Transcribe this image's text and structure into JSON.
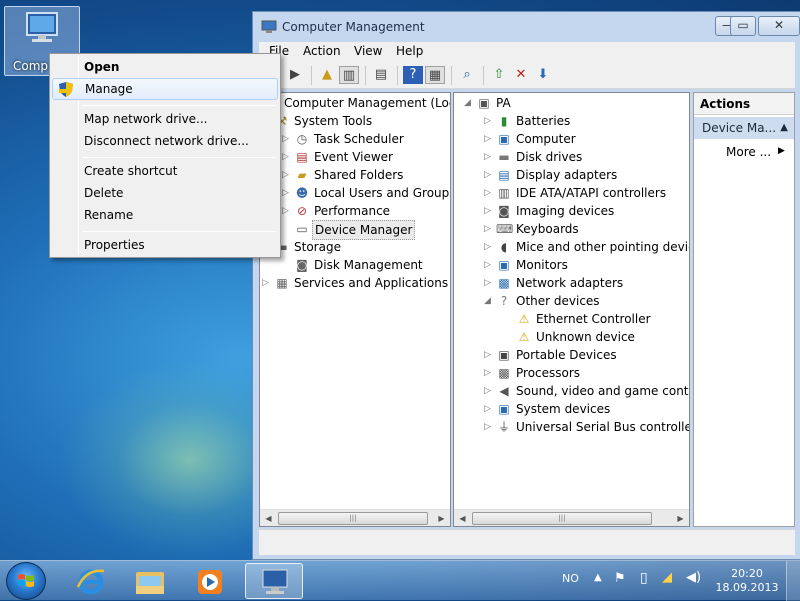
{
  "desktop": {
    "icon_label": "Comp"
  },
  "context_menu": {
    "items": [
      {
        "label": "Open"
      },
      {
        "label": "Manage"
      },
      {
        "label": "Map network drive..."
      },
      {
        "label": "Disconnect network drive..."
      },
      {
        "label": "Create shortcut"
      },
      {
        "label": "Delete"
      },
      {
        "label": "Rename"
      },
      {
        "label": "Properties"
      }
    ]
  },
  "window": {
    "title": "Computer Management",
    "controls": {
      "minimize": "—",
      "maximize": "▭",
      "close": "✕"
    },
    "menu": [
      "File",
      "Action",
      "View",
      "Help"
    ],
    "left_tree": [
      {
        "label": "Computer Management (Local",
        "icon": "computer-management-icon"
      },
      {
        "label": "System Tools",
        "icon": "tools-icon"
      },
      {
        "label": "Task Scheduler",
        "icon": "clock-icon"
      },
      {
        "label": "Event Viewer",
        "icon": "event-viewer-icon"
      },
      {
        "label": "Shared Folders",
        "icon": "shared-folder-icon"
      },
      {
        "label": "Local Users and Groups",
        "icon": "users-icon"
      },
      {
        "label": "Performance",
        "icon": "performance-icon"
      },
      {
        "label": "Device Manager",
        "icon": "device-manager-icon"
      },
      {
        "label": "Storage",
        "icon": "storage-icon"
      },
      {
        "label": "Disk Management",
        "icon": "disk-icon"
      },
      {
        "label": "Services and Applications",
        "icon": "services-icon"
      }
    ],
    "device_tree": [
      {
        "label": "PA"
      },
      {
        "label": "Batteries"
      },
      {
        "label": "Computer"
      },
      {
        "label": "Disk drives"
      },
      {
        "label": "Display adapters"
      },
      {
        "label": "IDE ATA/ATAPI controllers"
      },
      {
        "label": "Imaging devices"
      },
      {
        "label": "Keyboards"
      },
      {
        "label": "Mice and other pointing devices"
      },
      {
        "label": "Monitors"
      },
      {
        "label": "Network adapters"
      },
      {
        "label": "Other devices"
      },
      {
        "label": "Ethernet Controller"
      },
      {
        "label": "Unknown device"
      },
      {
        "label": "Portable Devices"
      },
      {
        "label": "Processors"
      },
      {
        "label": "Sound, video and game controllers"
      },
      {
        "label": "System devices"
      },
      {
        "label": "Universal Serial Bus controllers"
      }
    ],
    "actions": {
      "header": "Actions",
      "selected": "Device Ma...",
      "more": "More ..."
    }
  },
  "taskbar": {
    "language": "NO",
    "time": "20:20",
    "date": "18.09.2013"
  }
}
